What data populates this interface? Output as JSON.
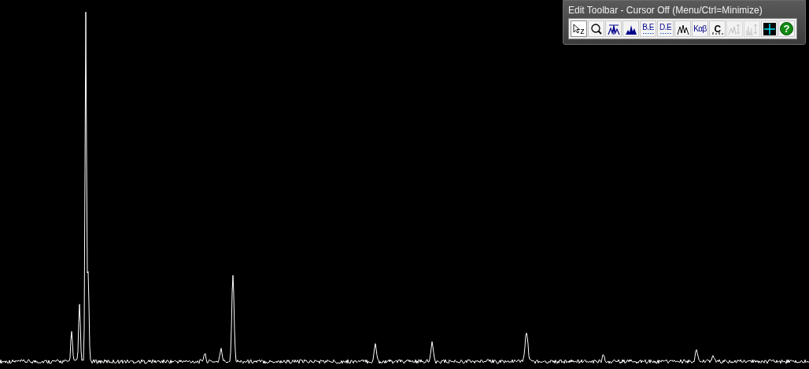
{
  "toolbar": {
    "title": "Edit Toolbar - Cursor Off (Menu/Ctrl=Minimize)",
    "buttons": [
      {
        "kind": "pointer-zoom",
        "label": "z",
        "selected": true,
        "disabled": false
      },
      {
        "kind": "magnifier",
        "selected": false,
        "disabled": false
      },
      {
        "kind": "peak-marker",
        "selected": false,
        "disabled": false
      },
      {
        "kind": "filled-peaks",
        "selected": false,
        "disabled": false
      },
      {
        "kind": "text-dotted",
        "label": "B.E",
        "selected": false,
        "disabled": false
      },
      {
        "kind": "text-dotted",
        "label": "D.E",
        "selected": false,
        "disabled": false
      },
      {
        "kind": "outline-peaks",
        "selected": false,
        "disabled": false
      },
      {
        "kind": "text",
        "label": "Kαβ",
        "selected": false,
        "disabled": false
      },
      {
        "kind": "text-ticks",
        "label": "C",
        "selected": false,
        "disabled": false
      },
      {
        "kind": "peak-arrows",
        "selected": false,
        "disabled": true
      },
      {
        "kind": "bar-arrows",
        "selected": false,
        "disabled": true
      },
      {
        "kind": "grid",
        "selected": false,
        "disabled": false
      },
      {
        "kind": "help",
        "label": "?",
        "selected": false,
        "disabled": false
      }
    ]
  }
}
